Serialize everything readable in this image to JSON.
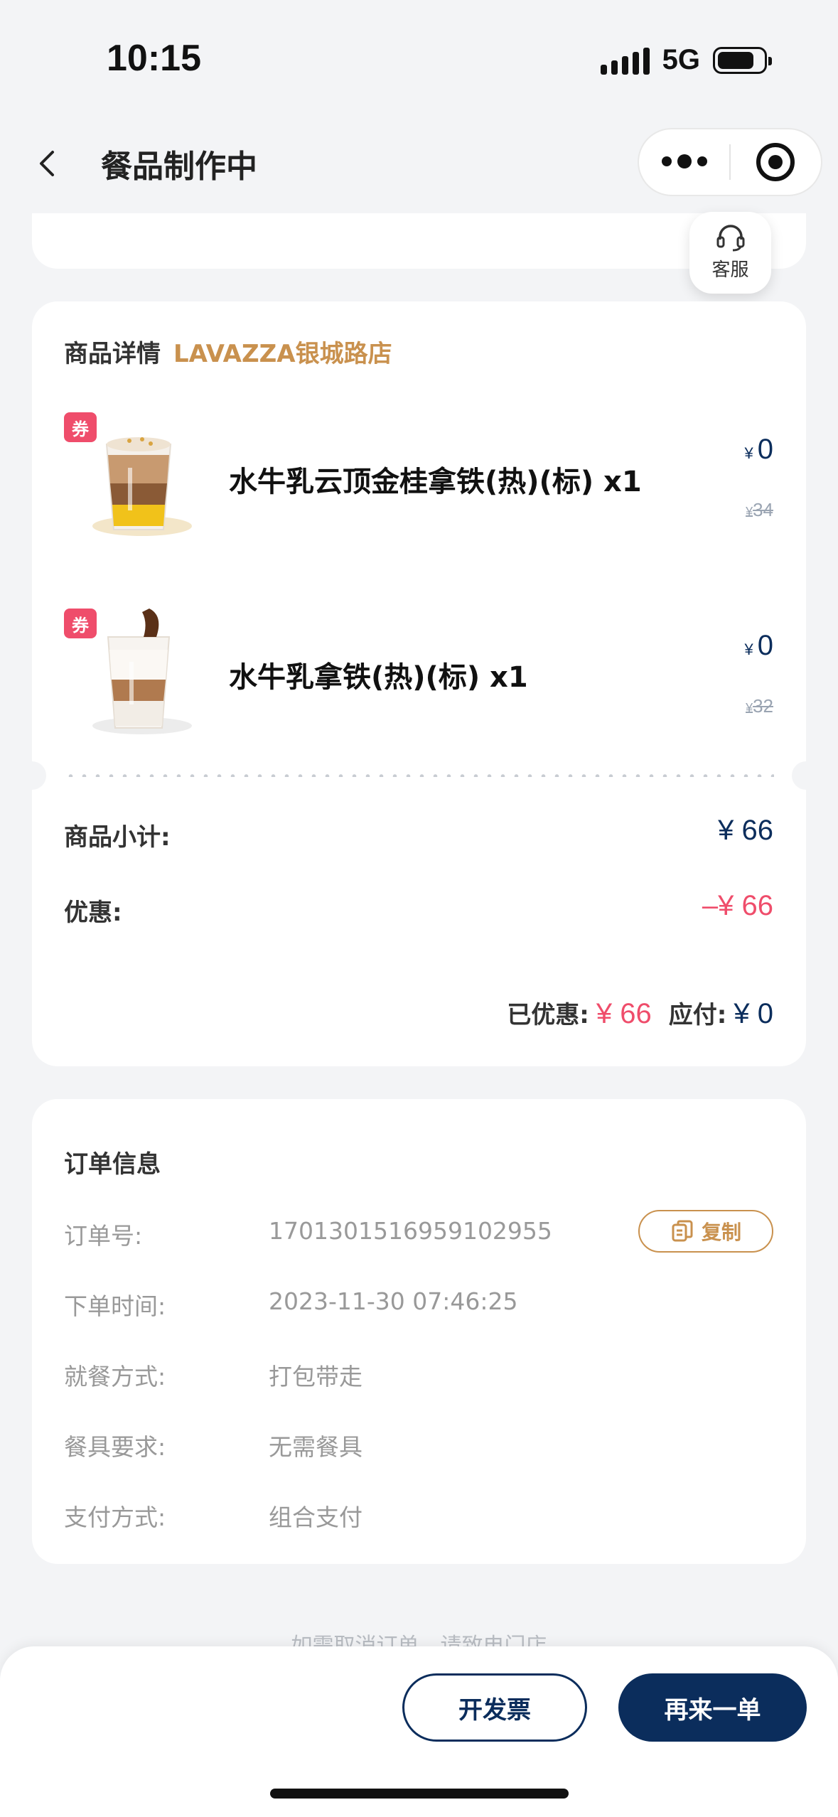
{
  "status_bar": {
    "time": "10:15",
    "network": "5G",
    "battery_level": 0.8
  },
  "nav": {
    "title": "餐品制作中"
  },
  "service": {
    "label": "客服",
    "icon": "headset-icon"
  },
  "goods": {
    "header": "商品详情",
    "store": "LAVAZZA银城路店",
    "items": [
      {
        "coupon": "券",
        "name": "水牛乳云顶金桂拿铁(热)(标) x1",
        "currency": "¥",
        "price": "0",
        "original_price": "34"
      },
      {
        "coupon": "券",
        "name": "水牛乳拿铁(热)(标) x1",
        "currency": "¥",
        "price": "0",
        "original_price": "32"
      }
    ],
    "subtotal_label": "商品小计:",
    "subtotal_value": "¥ 66",
    "discount_label": "优惠:",
    "discount_value": "–¥ 66",
    "saved_label": "已优惠:",
    "saved_value": "¥ 66",
    "payable_label": "应付:",
    "payable_value": "¥ 0"
  },
  "order": {
    "title": "订单信息",
    "rows": [
      {
        "label": "订单号:",
        "value": "1701301516959102955"
      },
      {
        "label": "下单时间:",
        "value": "2023-11-30 07:46:25"
      },
      {
        "label": "就餐方式:",
        "value": "打包带走"
      },
      {
        "label": "餐具要求:",
        "value": "无需餐具"
      },
      {
        "label": "支付方式:",
        "value": "组合支付"
      }
    ],
    "copy_label": "复制"
  },
  "hint": "如需取消订单，请致电门店",
  "actions": {
    "invoice": "开发票",
    "reorder": "再来一单"
  },
  "colors": {
    "navy": "#0b2d5c",
    "red": "#ef4d6b",
    "gold": "#c9914e"
  }
}
